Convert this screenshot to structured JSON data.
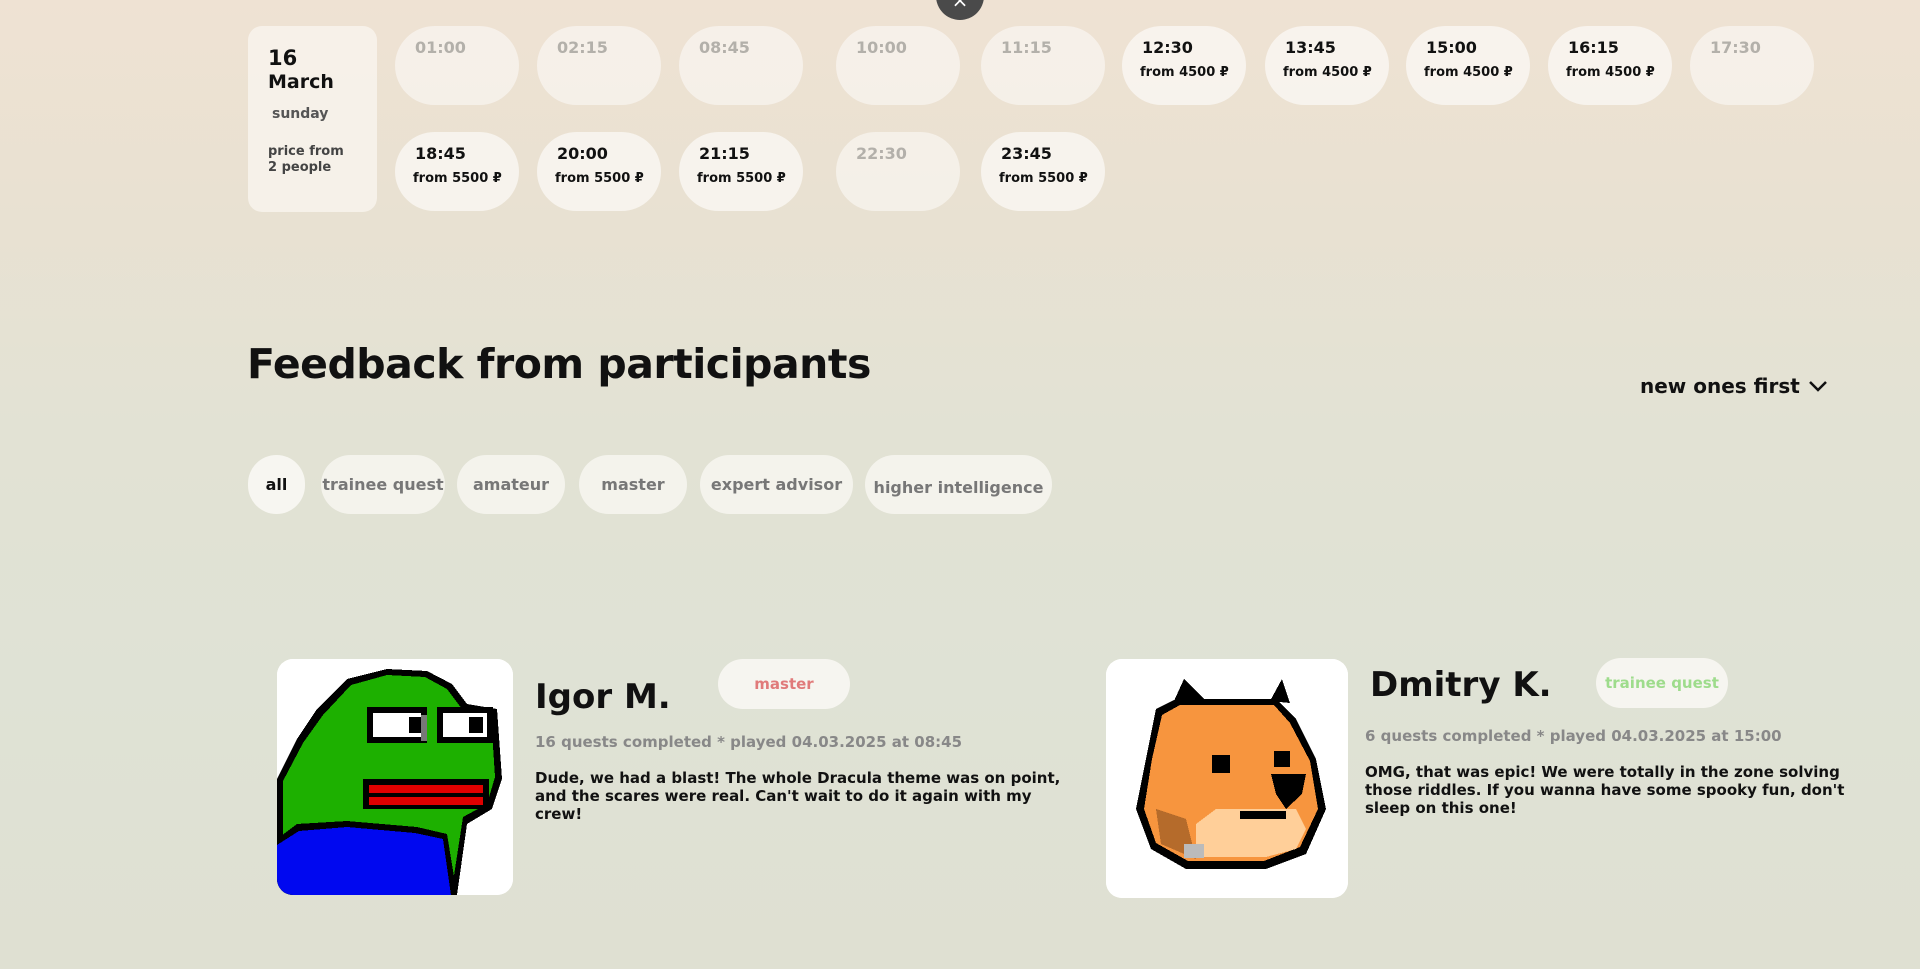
{
  "close_label": "×",
  "date_card": {
    "day": "16",
    "month": "March",
    "weekday": "sunday",
    "note": "price from 2 people"
  },
  "slots": [
    {
      "time": "01:00",
      "price": "",
      "available": false
    },
    {
      "time": "02:15",
      "price": "",
      "available": false
    },
    {
      "time": "08:45",
      "price": "",
      "available": false
    },
    {
      "time": "10:00",
      "price": "",
      "available": false
    },
    {
      "time": "11:15",
      "price": "",
      "available": false
    },
    {
      "time": "12:30",
      "price": "from 4500 ₽",
      "available": true
    },
    {
      "time": "13:45",
      "price": "from 4500 ₽",
      "available": true
    },
    {
      "time": "15:00",
      "price": "from 4500 ₽",
      "available": true
    },
    {
      "time": "16:15",
      "price": "from 4500 ₽",
      "available": true
    },
    {
      "time": "17:30",
      "price": "",
      "available": false
    },
    {
      "time": "18:45",
      "price": "from 5500 ₽",
      "available": true
    },
    {
      "time": "20:00",
      "price": "from 5500 ₽",
      "available": true
    },
    {
      "time": "21:15",
      "price": "from 5500 ₽",
      "available": true
    },
    {
      "time": "22:30",
      "price": "",
      "available": false
    },
    {
      "time": "23:45",
      "price": "from 5500 ₽",
      "available": true
    }
  ],
  "feedback": {
    "title": "Feedback from participants",
    "sort_label": "new ones first",
    "filters": [
      "all",
      "trainee quest",
      "amateur",
      "master",
      "expert advisor",
      "higher intelligence"
    ],
    "active_filter": "all"
  },
  "reviews": [
    {
      "name": "Igor M.",
      "badge": "master",
      "badge_color": "#e07a7a",
      "meta": "16 quests completed * played 04.03.2025 at 08:45",
      "text": "Dude, we had a blast! The whole Dracula theme was on point, and the scares were real. Can't wait to do it again with my crew!",
      "avatar_icon": "frog-avatar-icon"
    },
    {
      "name": "Dmitry K.",
      "badge": "trainee quest",
      "badge_color": "#9edc8c",
      "meta": "6 quests completed * played 04.03.2025 at 15:00",
      "text": "OMG, that was epic! We were totally in the zone solving those riddles. If you wanna have some spooky fun, don't sleep on this one!",
      "avatar_icon": "shiba-dog-avatar-icon"
    }
  ]
}
